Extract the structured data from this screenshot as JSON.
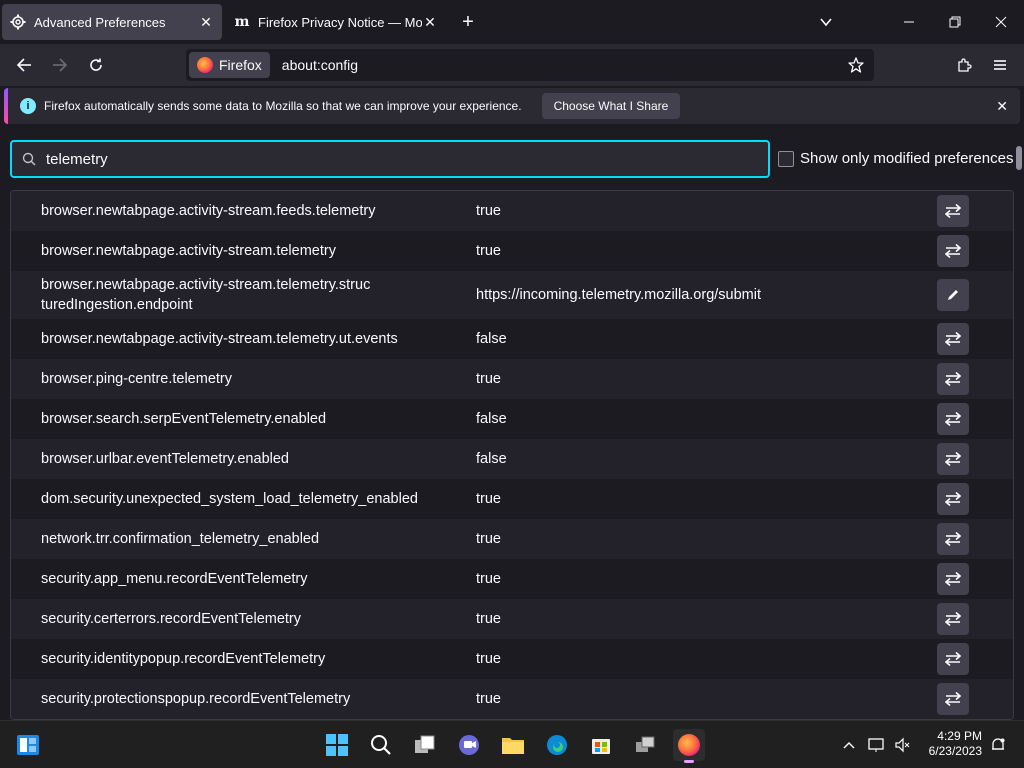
{
  "tabs": [
    {
      "title": "Advanced Preferences",
      "icon": "gear-icon",
      "active": true
    },
    {
      "title": "Firefox Privacy Notice — Mozilla",
      "icon": "mozilla-m-icon",
      "active": false
    }
  ],
  "nav": {
    "identity_label": "Firefox",
    "url": "about:config"
  },
  "notification": {
    "message": "Firefox automatically sends some data to Mozilla so that we can improve your experience.",
    "button_label": "Choose What I Share"
  },
  "search": {
    "value": "telemetry"
  },
  "show_modified_label": "Show only modified preferences",
  "prefs": [
    {
      "name": "browser.newtabpage.activity-stream.feeds.telemetry",
      "value": "true",
      "action": "toggle"
    },
    {
      "name": "browser.newtabpage.activity-stream.telemetry",
      "value": "true",
      "action": "toggle"
    },
    {
      "name": "browser.newtabpage.activity-stream.telemetry.structuredIngestion.endpoint",
      "value": "https://incoming.telemetry.mozilla.org/submit",
      "action": "edit"
    },
    {
      "name": "browser.newtabpage.activity-stream.telemetry.ut.events",
      "value": "false",
      "action": "toggle"
    },
    {
      "name": "browser.ping-centre.telemetry",
      "value": "true",
      "action": "toggle"
    },
    {
      "name": "browser.search.serpEventTelemetry.enabled",
      "value": "false",
      "action": "toggle"
    },
    {
      "name": "browser.urlbar.eventTelemetry.enabled",
      "value": "false",
      "action": "toggle"
    },
    {
      "name": "dom.security.unexpected_system_load_telemetry_enabled",
      "value": "true",
      "action": "toggle"
    },
    {
      "name": "network.trr.confirmation_telemetry_enabled",
      "value": "true",
      "action": "toggle"
    },
    {
      "name": "security.app_menu.recordEventTelemetry",
      "value": "true",
      "action": "toggle"
    },
    {
      "name": "security.certerrors.recordEventTelemetry",
      "value": "true",
      "action": "toggle"
    },
    {
      "name": "security.identitypopup.recordEventTelemetry",
      "value": "true",
      "action": "toggle"
    },
    {
      "name": "security.protectionspopup.recordEventTelemetry",
      "value": "true",
      "action": "toggle"
    }
  ],
  "taskbar": {
    "time": "4:29 PM",
    "date": "6/23/2023"
  },
  "colors": {
    "accent_focus": "#00ddff",
    "background": "#1c1b22",
    "toolbar": "#2b2a33"
  }
}
